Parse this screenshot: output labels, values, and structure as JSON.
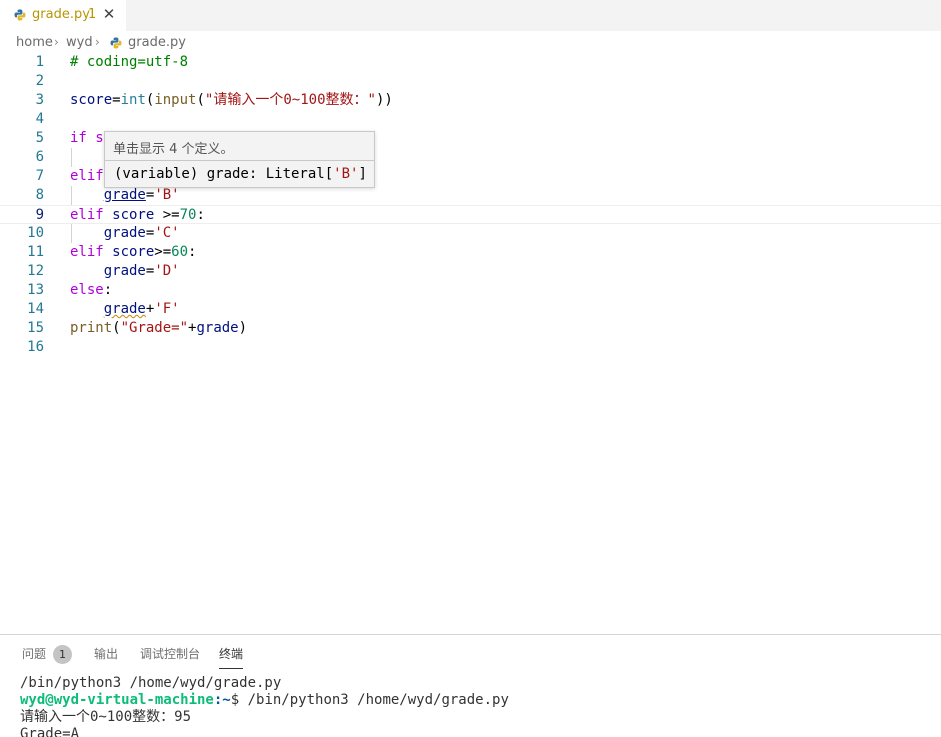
{
  "tab": {
    "filename": "grade.py",
    "badge": "1",
    "close": "✕"
  },
  "breadcrumb": {
    "items": [
      "home",
      "wyd",
      "grade.py"
    ],
    "separator": "›"
  },
  "editor": {
    "line_numbers": [
      "1",
      "2",
      "3",
      "4",
      "5",
      "6",
      "7",
      "8",
      "9",
      "10",
      "11",
      "12",
      "13",
      "14",
      "15",
      "16"
    ],
    "lines": {
      "l1": [
        "# coding=utf-8"
      ],
      "l3": [
        "score",
        "=",
        "int",
        "(",
        "input",
        "(",
        "\"请输入一个0~100整数：\"",
        "))"
      ],
      "l5": [
        "if s"
      ],
      "l7": [
        "elif"
      ],
      "l8": [
        "grade",
        "=",
        "'B'"
      ],
      "l9": [
        "elif",
        " score ",
        ">=",
        "70",
        ":"
      ],
      "l10": [
        "grade",
        "=",
        "'C'"
      ],
      "l11": [
        "elif",
        " score",
        ">=",
        "60",
        ":"
      ],
      "l12": [
        "grade",
        "=",
        "'D'"
      ],
      "l13": [
        "else",
        ":"
      ],
      "l14": [
        "grade",
        "+",
        "'F'"
      ],
      "l15": [
        "print",
        "(",
        "\"Grade=\"",
        "+",
        "grade",
        ")"
      ]
    }
  },
  "hover": {
    "title": "单击显示 4 个定义。",
    "sig_prefix": "(variable) grade: Literal[",
    "sig_value": "'B'",
    "sig_suffix": "]"
  },
  "panel": {
    "tabs": [
      "问题",
      "输出",
      "调试控制台",
      "终端"
    ],
    "problems_count": "1",
    "active_tab": "终端",
    "terminal": {
      "line1": "/bin/python3 /home/wyd/grade.py",
      "user": "wyd@wyd-virtual-machine",
      "path": ":~",
      "prompt_cmd": "$ /bin/python3 /home/wyd/grade.py",
      "line3": "请输入一个0~100整数：95",
      "line4": "Grade=A"
    }
  },
  "colors": {
    "accent_modified": "#b89500",
    "keyword": "#af00db",
    "string": "#a31515",
    "number": "#098658",
    "terminal_user": "#0dbc79"
  },
  "icons": [
    "python-file-icon",
    "close-icon",
    "chevron-right-icon"
  ]
}
